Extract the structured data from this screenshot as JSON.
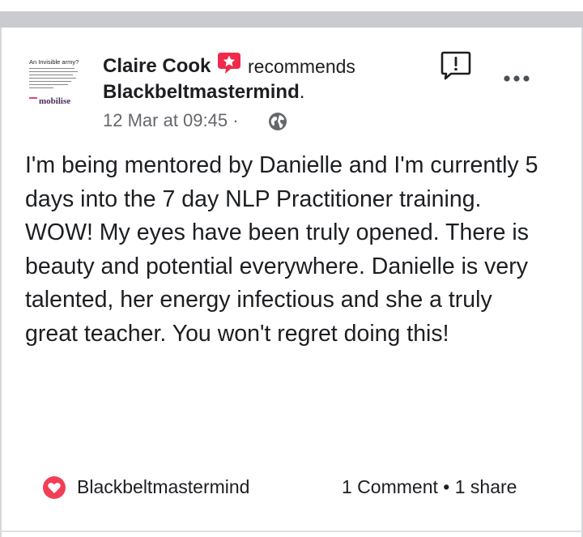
{
  "post": {
    "author": "Claire Cook",
    "action": "recommends",
    "page_name": "Blackbeltmastermind",
    "page_suffix": ".",
    "timestamp": "12 Mar at 09:45",
    "separator": "·",
    "text": "I'm being mentored by Danielle and I'm currently 5 days into the 7 day NLP Practitioner training.  WOW! My eyes have been truly opened. There is beauty and potential everywhere. Danielle is very talented, her energy infectious and she a truly great teacher. You won't regret doing this!"
  },
  "thumbnail": {
    "heading": "An Invisible army?",
    "brand": "mobilise"
  },
  "footer": {
    "reaction_label": "Blackbeltmastermind",
    "comments": "1 Comment",
    "bullet": "•",
    "shares": "1 share"
  },
  "icons": {
    "recommend": "recommend-star-icon",
    "report": "report-exclamation-icon",
    "more": "more-dots-icon",
    "audience": "globe-icon",
    "reaction": "heart-reaction-icon"
  },
  "colors": {
    "recommend_red": "#f02849",
    "secondary_text": "#65676b",
    "brand_pink": "#e0457b"
  }
}
